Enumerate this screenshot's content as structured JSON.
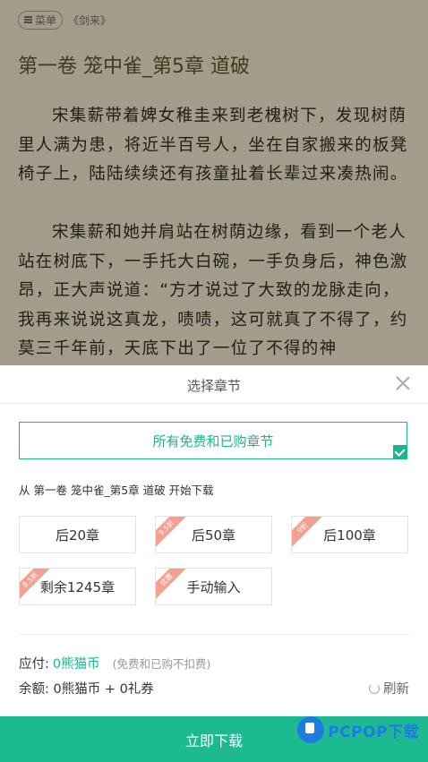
{
  "reader": {
    "menu_label": "菜单",
    "book_name": "《剑来》",
    "chapter_title": "第一卷 笼中雀_第5章 道破",
    "paragraphs": [
      "宋集薪带着婢女稚圭来到老槐树下，发现树荫里人满为患，将近半百号人，坐在自家搬来的板凳椅子上，陆陆续续还有孩童扯着长辈过来凑热闹。",
      "宋集薪和她并肩站在树荫边缘，看到一个老人站在树底下，一手托大白碗，一手负身后，神色激昂，正大声说道：“方才说过了大致的龙脉走向，我再来说说这真龙，啧啧，这可就真了不得了，约莫三千年前，天底下出了一位了不得的神"
    ]
  },
  "sheet": {
    "title": "选择章节",
    "all_chapters_label": "所有免费和已购章节",
    "from_text": "从  第一卷 笼中雀_第5章 道破  开始下载",
    "options": [
      {
        "label": "后20章",
        "badge": ""
      },
      {
        "label": "后50章",
        "badge": "9.5折"
      },
      {
        "label": "后100章",
        "badge": "9折"
      },
      {
        "label": "剩余1245章",
        "badge": "8.5折"
      },
      {
        "label": "手动输入",
        "badge": "优惠"
      }
    ],
    "pay_label": "应付:",
    "pay_value": "0熊猫币",
    "pay_note": "(免费和已购不扣费)",
    "balance_text": "余额: 0熊猫币 + 0礼券",
    "refresh_label": "刷新",
    "download_label": "立即下载"
  },
  "watermark": {
    "text": "PCPOP下载"
  },
  "colors": {
    "accent": "#1bb591",
    "ribbon": "#f3a090",
    "reader_bg": "#d9d0ba"
  }
}
